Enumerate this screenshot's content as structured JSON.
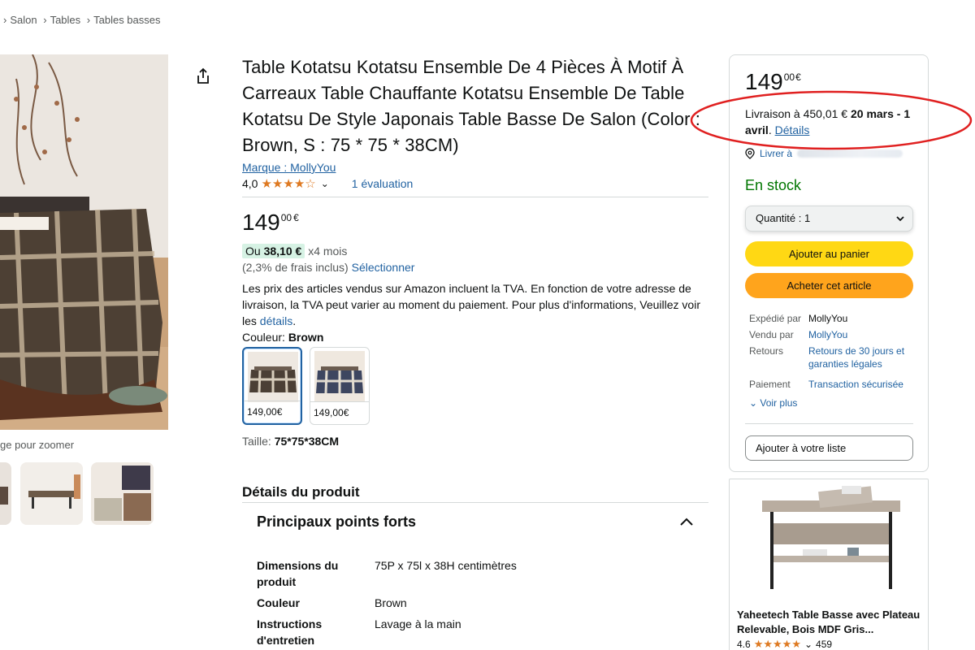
{
  "breadcrumb": {
    "items": [
      "Salon",
      "Tables",
      "Tables basses"
    ]
  },
  "gallery": {
    "zoom_hint": "ge pour zoomer"
  },
  "product": {
    "title": "Table Kotatsu Kotatsu Ensemble De 4 Pièces À Motif À Carreaux Table Chauffante Kotatsu Ensemble De Table Kotatsu De Style Japonais Table Basse De Salon (Color : Brown, S : 75 * 75 * 38CM)",
    "brand": "Marque : MollyYou",
    "rating": "4,0",
    "stars_value": 4.0,
    "review_count": "1 évaluation",
    "price_int": "149",
    "price_frac": "00",
    "currency": "€",
    "installment": {
      "prefix": "Ou",
      "amount": "38,10 €",
      "suffix": "x4 mois",
      "fees": "(2,3% de frais inclus)",
      "select": "Sélectionner"
    },
    "vat_text": "Les prix des articles vendus sur Amazon incluent la TVA. En fonction de votre adresse de livraison, la TVA peut varier au moment du paiement. Pour plus d'informations, Veuillez voir les",
    "vat_link": "détails",
    "vat_end": ".",
    "color_label": "Couleur:",
    "color_value": "Brown",
    "swatches": [
      {
        "price": "149,00€"
      },
      {
        "price": "149,00€"
      }
    ],
    "size_label": "Taille:",
    "size_value": "75*75*38CM"
  },
  "details": {
    "heading": "Détails du produit",
    "highlights": "Principaux points forts",
    "specs": [
      {
        "key": "Dimensions du produit",
        "value": "75P x 75l x 38H centimètres"
      },
      {
        "key": "Couleur",
        "value": "Brown"
      },
      {
        "key": "Instructions d'entretien",
        "value": "Lavage à la main"
      }
    ]
  },
  "buybox": {
    "price_int": "149",
    "price_frac": "00",
    "currency": "€",
    "delivery_prefix": "Livraison à 450,01 €",
    "delivery_dates": "20 mars - 1 avril",
    "delivery_link": "Détails",
    "deliver_to": "Livrer à",
    "stock": "En stock",
    "quantity": "Quantité : 1",
    "add_to_cart": "Ajouter au panier",
    "buy_now": "Acheter cet article",
    "info": [
      {
        "key": "Expédié par",
        "value": "MollyYou"
      },
      {
        "key": "Vendu par",
        "value": "MollyYou"
      },
      {
        "key": "Retours",
        "value": "Retours de 30 jours et garanties légales"
      },
      {
        "key": "Paiement",
        "value": "Transaction sécurisée"
      }
    ],
    "see_more": "Voir plus",
    "add_to_list": "Ajouter à votre liste"
  },
  "ad": {
    "title": "Yaheetech Table Basse avec Plateau Relevable, Bois MDF Gris...",
    "rating": "4.6",
    "stars_value": 4.6,
    "reviews": "459"
  },
  "colors": {
    "link": "#2162a1",
    "stock": "#007600",
    "cart": "#ffd814",
    "buy": "#ffa41c",
    "star": "#de7921",
    "annotation": "#e02020"
  }
}
